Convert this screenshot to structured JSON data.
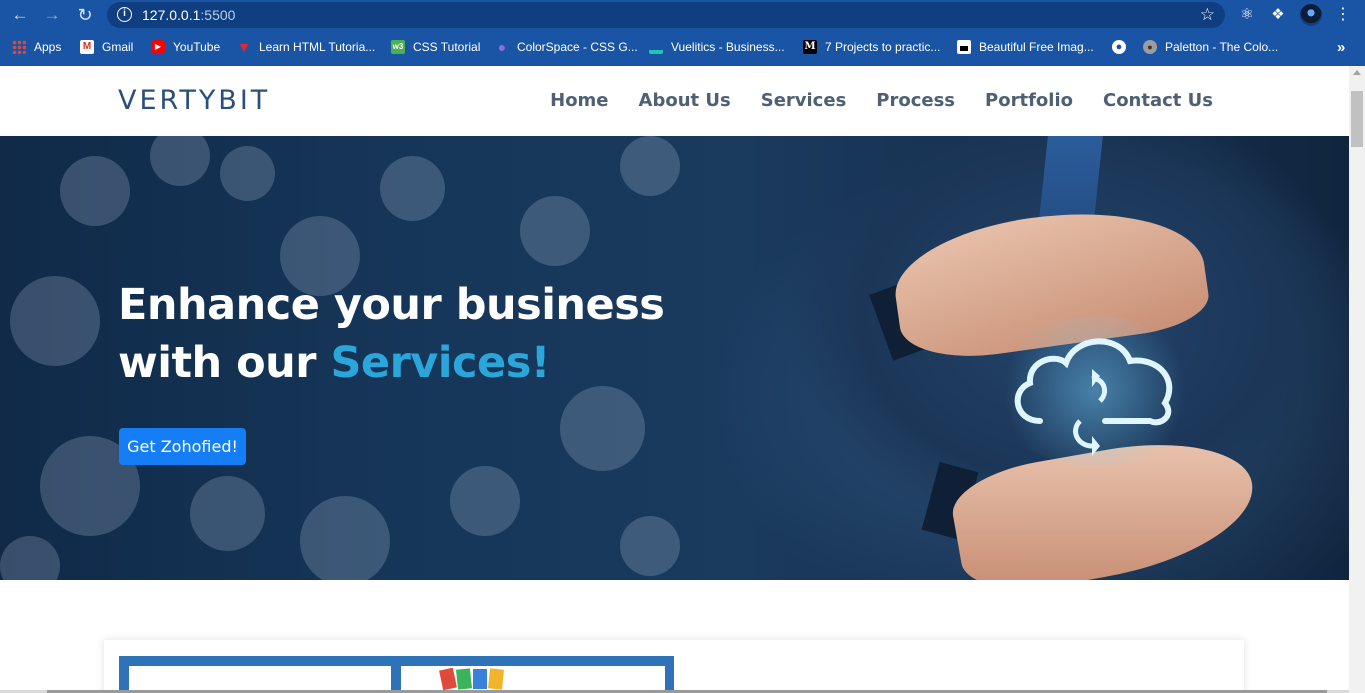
{
  "browser": {
    "url_host": "127.0.0.1",
    "url_port": ":5500",
    "back_icon": "back-arrow-icon",
    "forward_icon": "forward-arrow-icon",
    "reload_icon": "reload-icon",
    "info_icon": "info-icon",
    "star_icon": "star-icon",
    "extensions": [
      "react-icon",
      "puzzle-icon"
    ],
    "menu_icon": "kebab-menu-icon",
    "colors": {
      "frame": "#1a55a5",
      "omnibox": "#0f3f80"
    }
  },
  "bookmarks": [
    {
      "label": "Apps",
      "icon": "apps-grid-icon"
    },
    {
      "label": "Gmail",
      "icon": "gmail-icon"
    },
    {
      "label": "YouTube",
      "icon": "youtube-icon"
    },
    {
      "label": "Learn HTML Tutoria...",
      "icon": "v-icon"
    },
    {
      "label": "CSS Tutorial",
      "icon": "w3-icon"
    },
    {
      "label": "ColorSpace - CSS G...",
      "icon": "colorspace-icon"
    },
    {
      "label": "Vuelitics - Business...",
      "icon": "vuelitics-icon"
    },
    {
      "label": "7 Projects to practic...",
      "icon": "medium-icon"
    },
    {
      "label": "Beautiful Free Imag...",
      "icon": "unsplash-icon"
    },
    {
      "label": "",
      "icon": "globe-icon"
    },
    {
      "label": "Paletton - The Colo...",
      "icon": "paletton-icon"
    }
  ],
  "bookmarks_more": "»",
  "site": {
    "logo": "VERTYBIT",
    "nav": [
      "Home",
      "About Us",
      "Services",
      "Process",
      "Portfolio",
      "Contact Us"
    ],
    "hero": {
      "line1": "Enhance your business",
      "line2_prefix": "with our ",
      "line2_accent": "Services!",
      "cta": "Get Zohofied!"
    },
    "colors": {
      "accent": "#2aa6db",
      "cta": "#157ef6",
      "nav": "#4f6075",
      "logo": "#2a4f79"
    }
  }
}
